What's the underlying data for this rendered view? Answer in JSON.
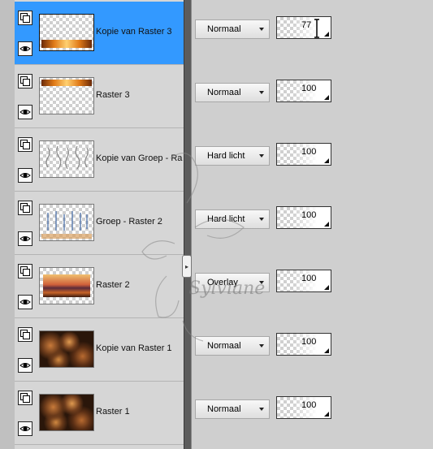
{
  "panel": {
    "title": ""
  },
  "layers": [
    {
      "name": "Kopie van Raster 3",
      "blend_mode": "Normaal",
      "opacity": "77",
      "selected": true,
      "thumb": "sunset-strip-bottom"
    },
    {
      "name": "Raster 3",
      "blend_mode": "Normaal",
      "opacity": "100",
      "selected": false,
      "thumb": "sunset-strip-top"
    },
    {
      "name": "Kopie van Groep - Ra",
      "blend_mode": "Hard licht",
      "opacity": "100",
      "selected": false,
      "thumb": "ornament-grey"
    },
    {
      "name": "Groep - Raster 2",
      "blend_mode": "Hard licht",
      "opacity": "100",
      "selected": false,
      "thumb": "ornament-blue"
    },
    {
      "name": "Raster 2",
      "blend_mode": "Overlay",
      "opacity": "100",
      "selected": false,
      "thumb": "sunset-landscape"
    },
    {
      "name": "Kopie van Raster 1",
      "blend_mode": "Normaal",
      "opacity": "100",
      "selected": false,
      "thumb": "bokeh-brown"
    },
    {
      "name": "Raster 1",
      "blend_mode": "Normaal",
      "opacity": "100",
      "selected": false,
      "thumb": "bokeh-brown"
    }
  ],
  "watermark": {
    "text": "Sylviane"
  },
  "colors": {
    "selected_row": "#3399ff",
    "panel_bg": "#d6d6d6",
    "splitter": "#5c5c5c"
  }
}
